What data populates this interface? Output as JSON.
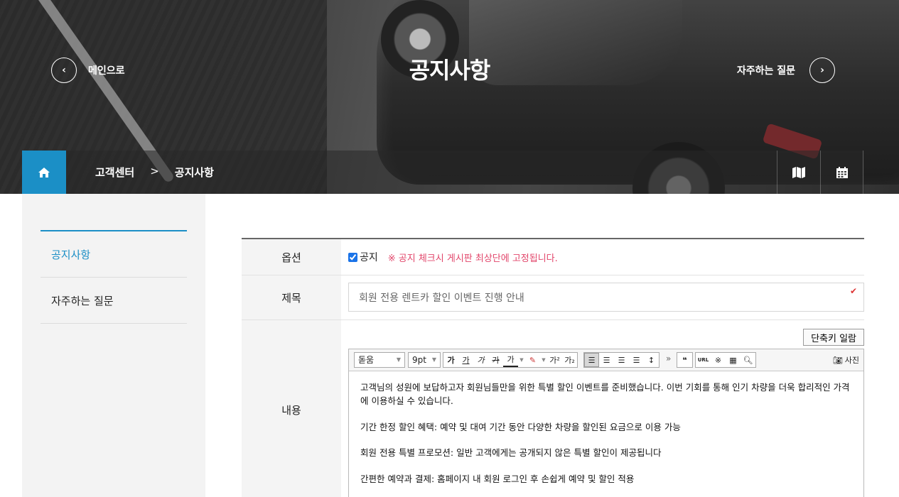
{
  "hero": {
    "title": "공지사항",
    "prev_label": "메인으로",
    "next_label": "자주하는 질문"
  },
  "breadcrumb": [
    "고객센터",
    "공지사항"
  ],
  "breadcrumb_separator": ">",
  "sidebar": {
    "items": [
      {
        "label": "공지사항",
        "active": true
      },
      {
        "label": "자주하는 질문",
        "active": false
      }
    ]
  },
  "form": {
    "option_label": "옵션",
    "notice_checkbox_label": "공지",
    "notice_checked": true,
    "notice_hint": "※ 공지 체크시 게시판 최상단에 고정됩니다.",
    "subject_label": "제목",
    "subject_value": "회원 전용 렌트카 할인 이벤트 진행 안내",
    "content_label": "내용",
    "shortcut_button": "단축키 일람"
  },
  "editor": {
    "font_select": "돋움",
    "size_select": "9pt",
    "format_buttons": [
      "가",
      "가",
      "가",
      "가",
      "가"
    ],
    "superscript": "가²",
    "subscript": "가₂",
    "more": "»",
    "quote": "❝",
    "url_button": "URL",
    "photo_button": "사진",
    "paragraphs": [
      "고객님의 성원에 보답하고자 회원님들만을 위한 특별 할인 이벤트를 준비했습니다. 이번 기회를 통해 인기 차량을 더욱 합리적인 가격에 이용하실 수 있습니다.",
      "기간 한정 할인 혜택: 예약 및 대여 기간 동안 다양한 차량을 할인된 요금으로 이용 가능",
      "회원 전용 특별 프로모션: 일반 고객에게는 공개되지 않은 특별 할인이 제공됩니다",
      "간편한 예약과 결제: 홈페이지 내 회원 로그인 후 손쉽게 예약 및 할인 적용"
    ]
  },
  "colors": {
    "accent": "#1b8fc6",
    "notice": "#e2456a"
  }
}
